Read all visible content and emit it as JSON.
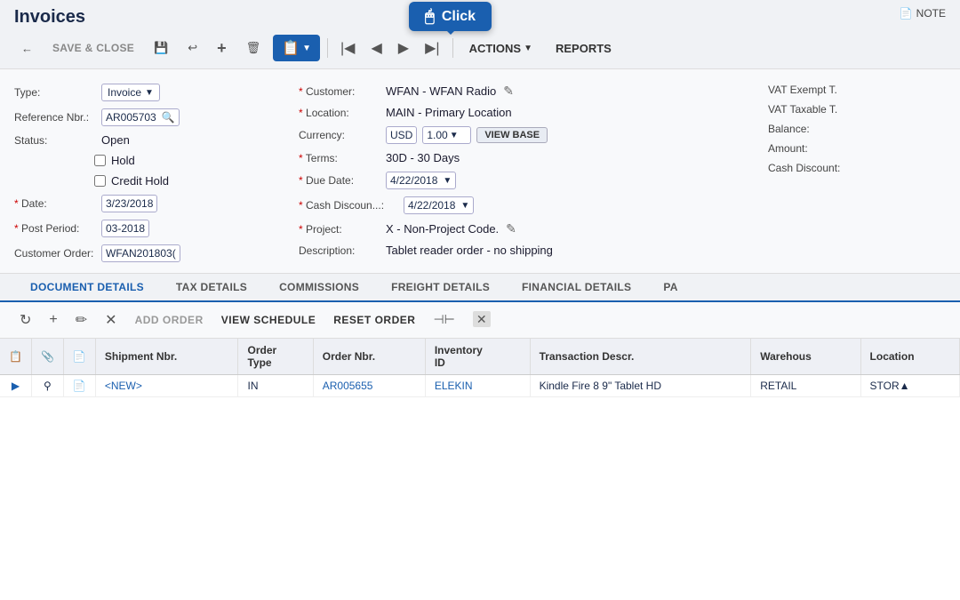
{
  "title": "Invoices",
  "note_button": "NOTE",
  "click_tooltip": "Click",
  "toolbar": {
    "save_close": "SAVE & CLOSE",
    "back_icon": "←",
    "save_icon": "💾",
    "undo_icon": "↩",
    "add_icon": "+",
    "delete_icon": "🗑",
    "copy_icon": "📋",
    "first_icon": "|◀",
    "prev_icon": "◀",
    "next_icon": "▶",
    "last_icon": "▶|",
    "actions": "ACTIONS",
    "reports": "REPORTS"
  },
  "form": {
    "type_label": "Type:",
    "type_value": "Invoice",
    "ref_label": "Reference Nbr.:",
    "ref_value": "AR005703",
    "status_label": "Status:",
    "status_value": "Open",
    "hold_label": "Hold",
    "credit_hold_label": "Credit Hold",
    "date_label": "* Date:",
    "date_value": "3/23/2018",
    "post_period_label": "* Post Period:",
    "post_period_value": "03-2018",
    "customer_order_label": "Customer Order:",
    "customer_order_value": "WFAN201803(",
    "customer_label": "* Customer:",
    "customer_value": "WFAN - WFAN Radio",
    "location_label": "* Location:",
    "location_value": "MAIN - Primary Location",
    "currency_label": "Currency:",
    "currency_value": "USD",
    "currency_rate": "1.00",
    "view_base": "VIEW BASE",
    "terms_label": "* Terms:",
    "terms_value": "30D - 30 Days",
    "due_date_label": "* Due Date:",
    "due_date_value": "4/22/2018",
    "cash_discount_label": "* Cash Discoun...:",
    "cash_discount_value": "4/22/2018",
    "project_label": "* Project:",
    "project_value": "X - Non-Project Code.",
    "description_label": "Description:",
    "description_value": "Tablet reader order - no shipping",
    "vat_exempt_label": "VAT Exempt T.",
    "vat_taxable_label": "VAT Taxable T.",
    "balance_label": "Balance:",
    "amount_label": "Amount:",
    "cash_discount2_label": "Cash Discount:"
  },
  "tabs": [
    {
      "label": "DOCUMENT DETAILS",
      "active": true
    },
    {
      "label": "TAX DETAILS",
      "active": false
    },
    {
      "label": "COMMISSIONS",
      "active": false
    },
    {
      "label": "FREIGHT DETAILS",
      "active": false
    },
    {
      "label": "FINANCIAL DETAILS",
      "active": false
    },
    {
      "label": "PA",
      "active": false
    }
  ],
  "detail_toolbar": {
    "refresh_icon": "↻",
    "add_icon": "+",
    "edit_icon": "✏",
    "delete_icon": "✕",
    "add_order": "ADD ORDER",
    "view_schedule": "VIEW SCHEDULE",
    "reset_order": "RESET ORDER",
    "fit_icon": "⊣⊢",
    "clear_icon": "✕"
  },
  "table": {
    "columns": [
      {
        "label": "",
        "type": "icon1"
      },
      {
        "label": "",
        "type": "icon2"
      },
      {
        "label": "",
        "type": "icon3"
      },
      {
        "label": "Shipment Nbr.",
        "key": "shipment_nbr"
      },
      {
        "label": "Order\nType",
        "key": "order_type"
      },
      {
        "label": "Order Nbr.",
        "key": "order_nbr"
      },
      {
        "label": "Inventory\nID",
        "key": "inventory_id"
      },
      {
        "label": "Transaction Descr.",
        "key": "transaction_descr"
      },
      {
        "label": "Warehous",
        "key": "warehouse"
      },
      {
        "label": "Location",
        "key": "location"
      }
    ],
    "rows": [
      {
        "icon1": "▶",
        "icon2": "⚲",
        "icon3": "📄",
        "shipment_nbr": "<NEW>",
        "order_type": "IN",
        "order_nbr": "AR005655",
        "inventory_id": "ELEKIN",
        "transaction_descr": "Kindle Fire 8 9\" Tablet HD",
        "warehouse": "RETAIL",
        "location": "STOR▲"
      }
    ]
  }
}
